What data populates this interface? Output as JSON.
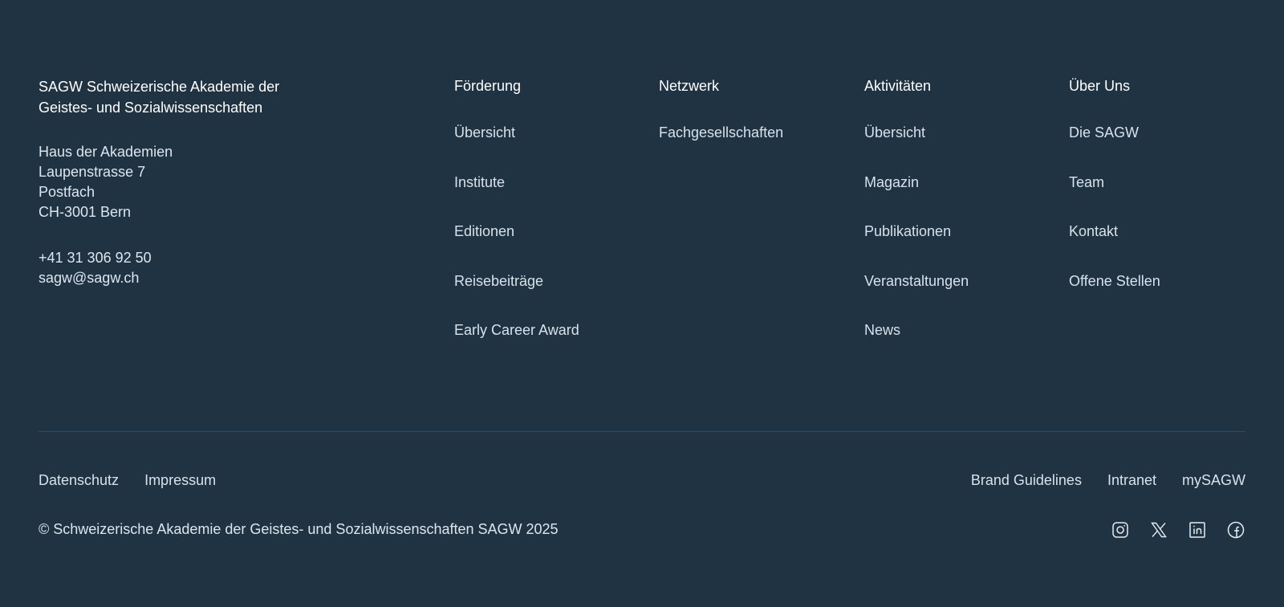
{
  "organization": {
    "name": "SAGW Schweizerische Akademie der Geistes- und Sozialwissenschaften",
    "address": [
      "Haus der Akademien",
      "Laupenstrasse 7",
      "Postfach",
      "CH-3001 Bern"
    ],
    "phone": "+41 31 306 92 50",
    "email": "sagw@sagw.ch"
  },
  "nav": {
    "foerderung": {
      "title": "Förderung",
      "items": [
        "Übersicht",
        "Institute",
        "Editionen",
        "Reisebeiträge",
        "Early Career Award"
      ]
    },
    "netzwerk": {
      "title": "Netzwerk",
      "items": [
        "Fachgesellschaften"
      ]
    },
    "aktivitaeten": {
      "title": "Aktivitäten",
      "items": [
        "Übersicht",
        "Magazin",
        "Publikationen",
        "Veranstaltungen",
        "News"
      ]
    },
    "ueber_uns": {
      "title": "Über Uns",
      "items": [
        "Die SAGW",
        "Team",
        "Kontakt",
        "Offene Stellen"
      ]
    }
  },
  "legal": {
    "left": [
      "Datenschutz",
      "Impressum"
    ],
    "right": [
      "Brand Guidelines",
      "Intranet",
      "mySAGW"
    ]
  },
  "copyright": "© Schweizerische Akademie der Geistes- und Sozialwissenschaften SAGW 2025",
  "social": [
    "instagram-icon",
    "x-icon",
    "linkedin-icon",
    "facebook-icon"
  ],
  "colors": {
    "background": "#203343",
    "divider": "#2b4a63",
    "text": "#d7e2ea"
  }
}
